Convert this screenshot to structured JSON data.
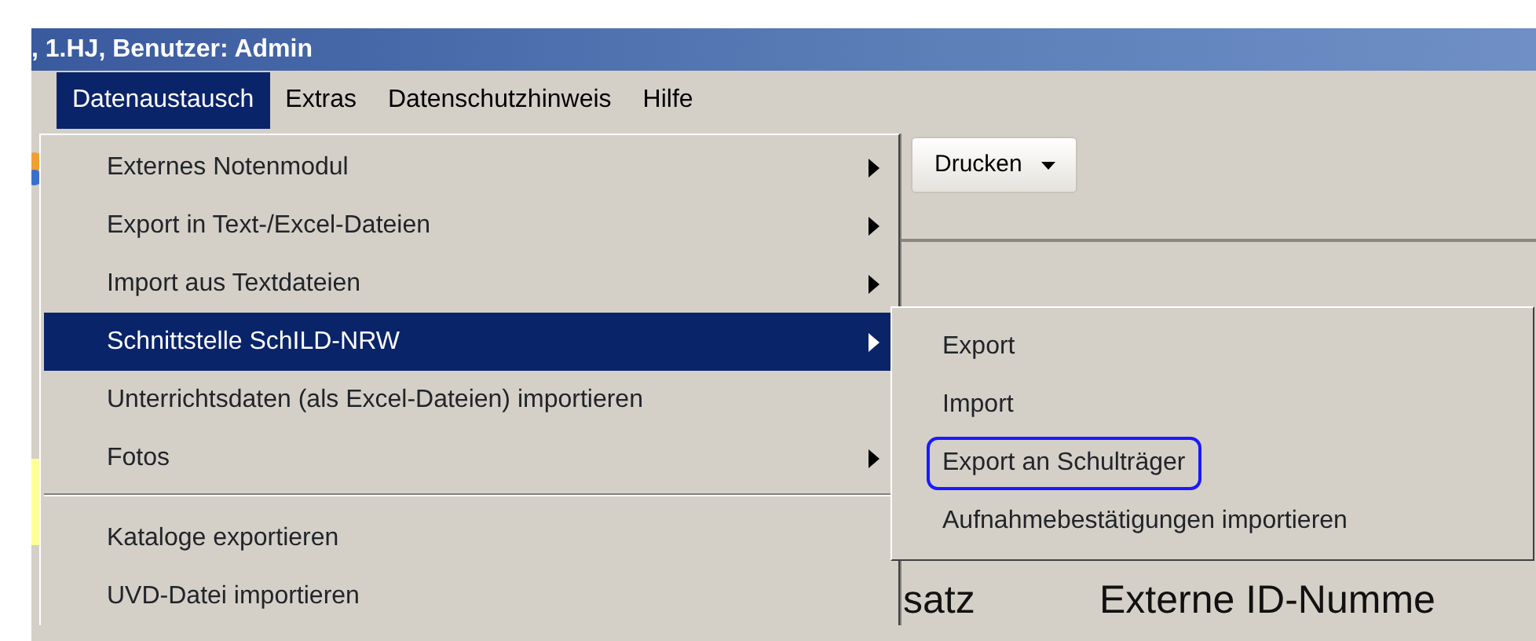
{
  "window": {
    "title": ", 1.HJ, Benutzer: Admin"
  },
  "menu_bar": [
    {
      "label": "Datenaustausch",
      "selected": true
    },
    {
      "label": "Extras",
      "selected": false
    },
    {
      "label": "Datenschutzhinweis",
      "selected": false
    },
    {
      "label": "Hilfe",
      "selected": false
    }
  ],
  "menu": {
    "items": [
      {
        "kind": "item",
        "label": "Externes Notenmodul",
        "submenu": true,
        "selected": false
      },
      {
        "kind": "item",
        "label": "Export in Text-/Excel-Dateien",
        "submenu": true,
        "selected": false
      },
      {
        "kind": "item",
        "label": "Import aus Textdateien",
        "submenu": true,
        "selected": false
      },
      {
        "kind": "item",
        "label": "Schnittstelle SchILD-NRW",
        "submenu": true,
        "selected": true
      },
      {
        "kind": "item",
        "label": "Unterrichtsdaten (als Excel-Dateien) importieren",
        "submenu": false,
        "selected": false
      },
      {
        "kind": "item",
        "label": "Fotos",
        "submenu": true,
        "selected": false
      },
      {
        "kind": "separator"
      },
      {
        "kind": "item",
        "label": "Kataloge exportieren",
        "submenu": false,
        "selected": false
      },
      {
        "kind": "item",
        "label": "UVD-Datei importieren",
        "submenu": false,
        "selected": false
      }
    ]
  },
  "submenu": {
    "items": [
      {
        "label": "Export",
        "highlighted": false
      },
      {
        "label": "Import",
        "highlighted": false
      },
      {
        "label": "Export an Schulträger",
        "highlighted": true
      },
      {
        "label": "Aufnahmebestätigungen importieren",
        "highlighted": false
      }
    ]
  },
  "toolbar": {
    "print_button": "Drucken"
  },
  "form": {
    "label_1": "satz",
    "label_2": "Externe ID-Numme"
  }
}
